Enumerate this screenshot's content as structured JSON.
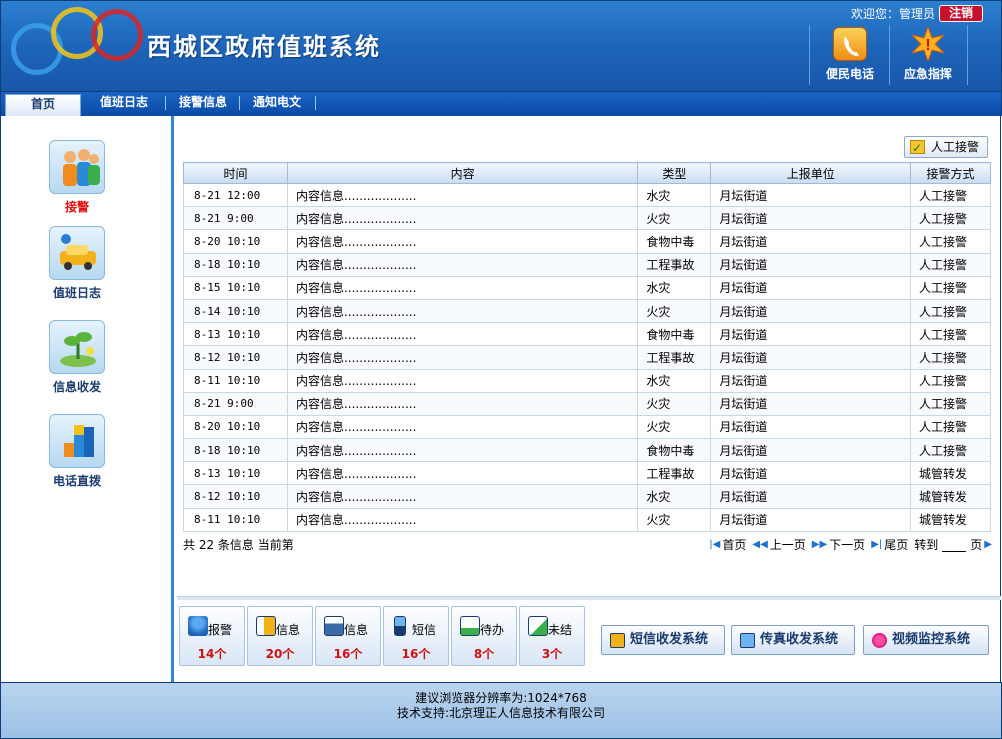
{
  "header": {
    "title": "西城区政府值班系统",
    "welcome": "欢迎您：管理员",
    "logout_label": "注销",
    "buttons": [
      {
        "label": "便民电话",
        "icon": "phone-icon"
      },
      {
        "label": "应急指挥",
        "icon": "alert-burst-icon"
      }
    ]
  },
  "nav": {
    "tabs": [
      {
        "label": "首页",
        "active": true
      },
      {
        "label": "值班日志"
      },
      {
        "label": "接警信息"
      },
      {
        "label": "通知电文"
      }
    ]
  },
  "sidebar": {
    "items": [
      {
        "label": "接警",
        "icon": "people-icon",
        "active": true
      },
      {
        "label": "值班日志",
        "icon": "car-icon"
      },
      {
        "label": "信息收发",
        "icon": "plant-icon"
      },
      {
        "label": "电话直拨",
        "icon": "blocks-icon"
      }
    ]
  },
  "main": {
    "manual_alarm_label": "人工接警",
    "table": {
      "columns": [
        "时间",
        "内容",
        "类型",
        "上报单位",
        "接警方式"
      ],
      "rows": [
        [
          "8-21 12:00",
          "内容信息...................",
          "水灾",
          "月坛街道",
          "人工接警"
        ],
        [
          "8-21 9:00",
          "内容信息...................",
          "火灾",
          "月坛街道",
          "人工接警"
        ],
        [
          "8-20 10:10",
          "内容信息...................",
          "食物中毒",
          "月坛街道",
          "人工接警"
        ],
        [
          "8-18 10:10",
          "内容信息...................",
          "工程事故",
          "月坛街道",
          "人工接警"
        ],
        [
          "8-15 10:10",
          "内容信息...................",
          "水灾",
          "月坛街道",
          "人工接警"
        ],
        [
          "8-14 10:10",
          "内容信息...................",
          "火灾",
          "月坛街道",
          "人工接警"
        ],
        [
          "8-13 10:10",
          "内容信息...................",
          "食物中毒",
          "月坛街道",
          "人工接警"
        ],
        [
          "8-12 10:10",
          "内容信息...................",
          "工程事故",
          "月坛街道",
          "人工接警"
        ],
        [
          "8-11 10:10",
          "内容信息...................",
          "水灾",
          "月坛街道",
          "人工接警"
        ],
        [
          "8-21 9:00",
          "内容信息...................",
          "火灾",
          "月坛街道",
          "人工接警"
        ],
        [
          "8-20 10:10",
          "内容信息...................",
          "火灾",
          "月坛街道",
          "人工接警"
        ],
        [
          "8-18 10:10",
          "内容信息...................",
          "食物中毒",
          "月坛街道",
          "人工接警"
        ],
        [
          "8-13 10:10",
          "内容信息...................",
          "工程事故",
          "月坛街道",
          "城管转发"
        ],
        [
          "8-12 10:10",
          "内容信息...................",
          "水灾",
          "月坛街道",
          "城管转发"
        ],
        [
          "8-11 10:10",
          "内容信息...................",
          "火灾",
          "月坛街道",
          "城管转发"
        ]
      ]
    },
    "record_info": "共 22 条信息 当前第",
    "pager": {
      "first": "首页",
      "prev": "上一页",
      "next": "下一页",
      "last": "尾页",
      "goto": "转到",
      "page_suffix": "页",
      "page_value": ""
    },
    "stats": [
      {
        "label": "报警",
        "count": "14个",
        "icon": "person-icon"
      },
      {
        "label": "信息",
        "count": "20个",
        "icon": "sort-icon"
      },
      {
        "label": "信息",
        "count": "16个",
        "icon": "printer-icon"
      },
      {
        "label": "短信",
        "count": "16个",
        "icon": "mobile-icon"
      },
      {
        "label": "待办",
        "count": "8个",
        "icon": "calendar-icon"
      },
      {
        "label": "未结",
        "count": "3个",
        "icon": "edit-icon"
      }
    ],
    "systems": [
      {
        "label": "短信收发系统",
        "icon": "sms-icon"
      },
      {
        "label": "传真收发系统",
        "icon": "fax-icon"
      },
      {
        "label": "视频监控系统",
        "icon": "video-icon"
      }
    ]
  },
  "footer": {
    "line1": "建议浏览器分辨率为:1024*768",
    "line2": "技术支持:北京理正人信息技术有限公司"
  }
}
